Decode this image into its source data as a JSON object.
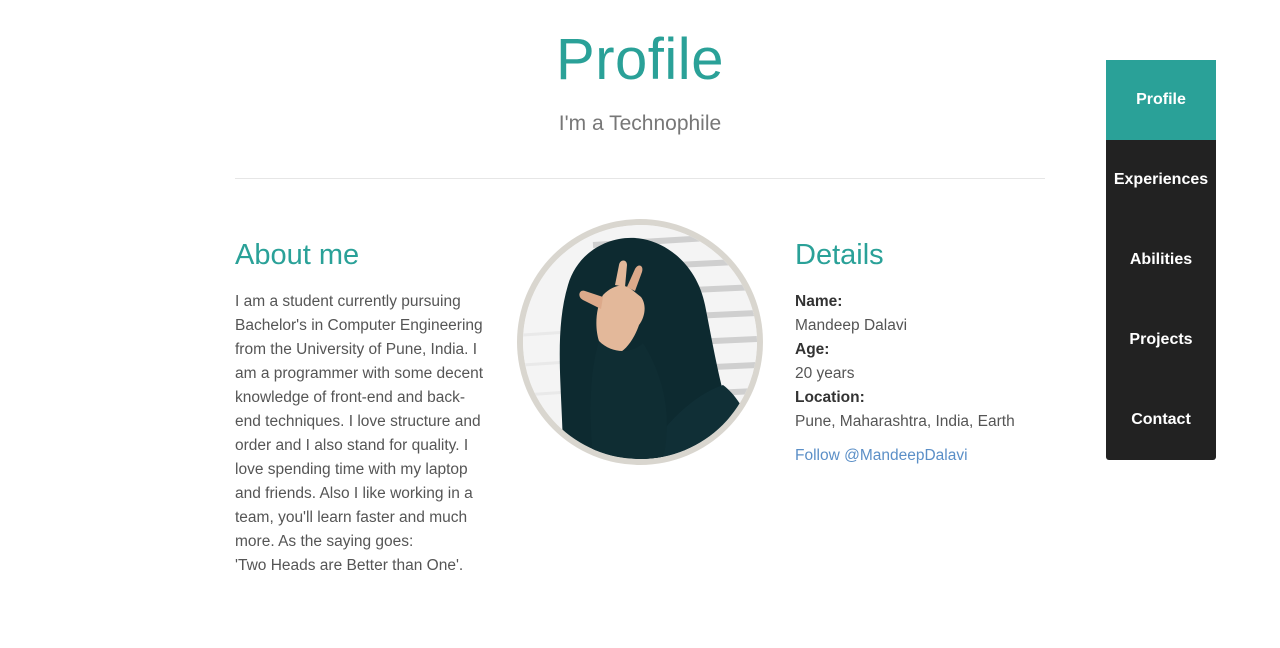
{
  "header": {
    "title": "Profile",
    "subtitle": "I'm a Technophile"
  },
  "about": {
    "heading": "About me",
    "paragraph": "I am a student currently pursuing Bachelor's in Computer Engineering from the University of Pune, India. I am a programmer with some decent knowledge of front-end and back-end techniques. I love structure and order and I also stand for quality. I love spending time with my laptop and friends. Also I like working in a team, you'll learn faster and much more. As the saying goes:",
    "quote": "'Two Heads are Better than One'."
  },
  "details": {
    "heading": "Details",
    "name_label": "Name:",
    "name_value": "Mandeep Dalavi",
    "age_label": "Age:",
    "age_value": "20 years",
    "location_label": "Location:",
    "location_value": "Pune, Maharashtra, India, Earth",
    "follow_link": "Follow @MandeepDalavi"
  },
  "nav": {
    "items": [
      {
        "label": "Profile",
        "active": true
      },
      {
        "label": "Experiences",
        "active": false
      },
      {
        "label": "Abilities",
        "active": false
      },
      {
        "label": "Projects",
        "active": false
      },
      {
        "label": "Contact",
        "active": false
      }
    ]
  },
  "colors": {
    "accent": "#2aa198",
    "nav_background": "#222222",
    "link": "#5b8fc7"
  }
}
